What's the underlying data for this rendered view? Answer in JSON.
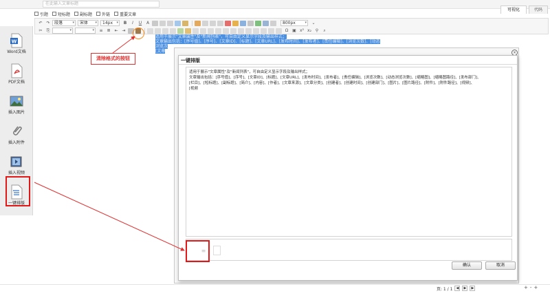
{
  "header": {
    "title_placeholder": "在此输入文章标题",
    "options": [
      "引题",
      "短标题",
      "副标题",
      "外链",
      "重要文章"
    ],
    "tabs": [
      "可视化",
      "代码"
    ]
  },
  "toolbar": {
    "paragraph_select": "段落",
    "font_select": "宋体",
    "size_select": "14px",
    "width_select": "800px",
    "bold": "B",
    "italic": "I",
    "underline": "U",
    "text_color": "A"
  },
  "sidebar": {
    "items": [
      {
        "label": "Word文档",
        "icon": "word-icon"
      },
      {
        "label": "PDF文档",
        "icon": "pdf-icon"
      },
      {
        "label": "插入图片",
        "icon": "image-icon"
      },
      {
        "label": "插入附件",
        "icon": "paperclip-icon"
      },
      {
        "label": "插入视频",
        "icon": "video-icon"
      },
      {
        "label": "一键排版",
        "icon": "typeset-icon"
      }
    ]
  },
  "editor": {
    "selected_lines": [
      "适用于展示\"文章属性\"及\"新闻列表\"，可自由定义显示字段及输出样式；",
      "文章输出包括：[序号值]、[序号]、[文章ID]、[标题]、[文章URL]、[发布时间]、[发布者]、[责任编辑]、[浏览次数]、[动态",
      "浏览次",
      "[文章"
    ]
  },
  "annotation": {
    "callout": "清除格式的按钮",
    "accent_color": "#e03030",
    "circle_color": "#ff8c1a"
  },
  "dialog": {
    "title": "一键排版",
    "close_symbol": "×",
    "content_lines": [
      "适用于展示\"文章属性\"及\"新闻列表\"，可自由定义显示字段及输出样式；",
      "文章输出包括：[序号值]、[序号]、[文章ID]、[标题]、[文章URL]、[发布时间]、[发布者]、[责任编辑]、[浏览次数]、[动态浏览次数]、[缩略图]、[缩略图路径]、[发布部门]、",
      "[栏目]、[短标题]、[副标题]、[简介]、[内容]、[作者]、[文章来源]、[文章分类]、[创建者]、[创建时间]、[创建部门]、[图片]、[图片路径]、[附件]、[附件路径]、[视频]、",
      "[视频"
    ],
    "ok_label": "确认",
    "cancel_label": "取消"
  },
  "footer": {
    "page_label": "页: 1 / 1",
    "zoom_minus": "-",
    "zoom_plus": "+"
  }
}
